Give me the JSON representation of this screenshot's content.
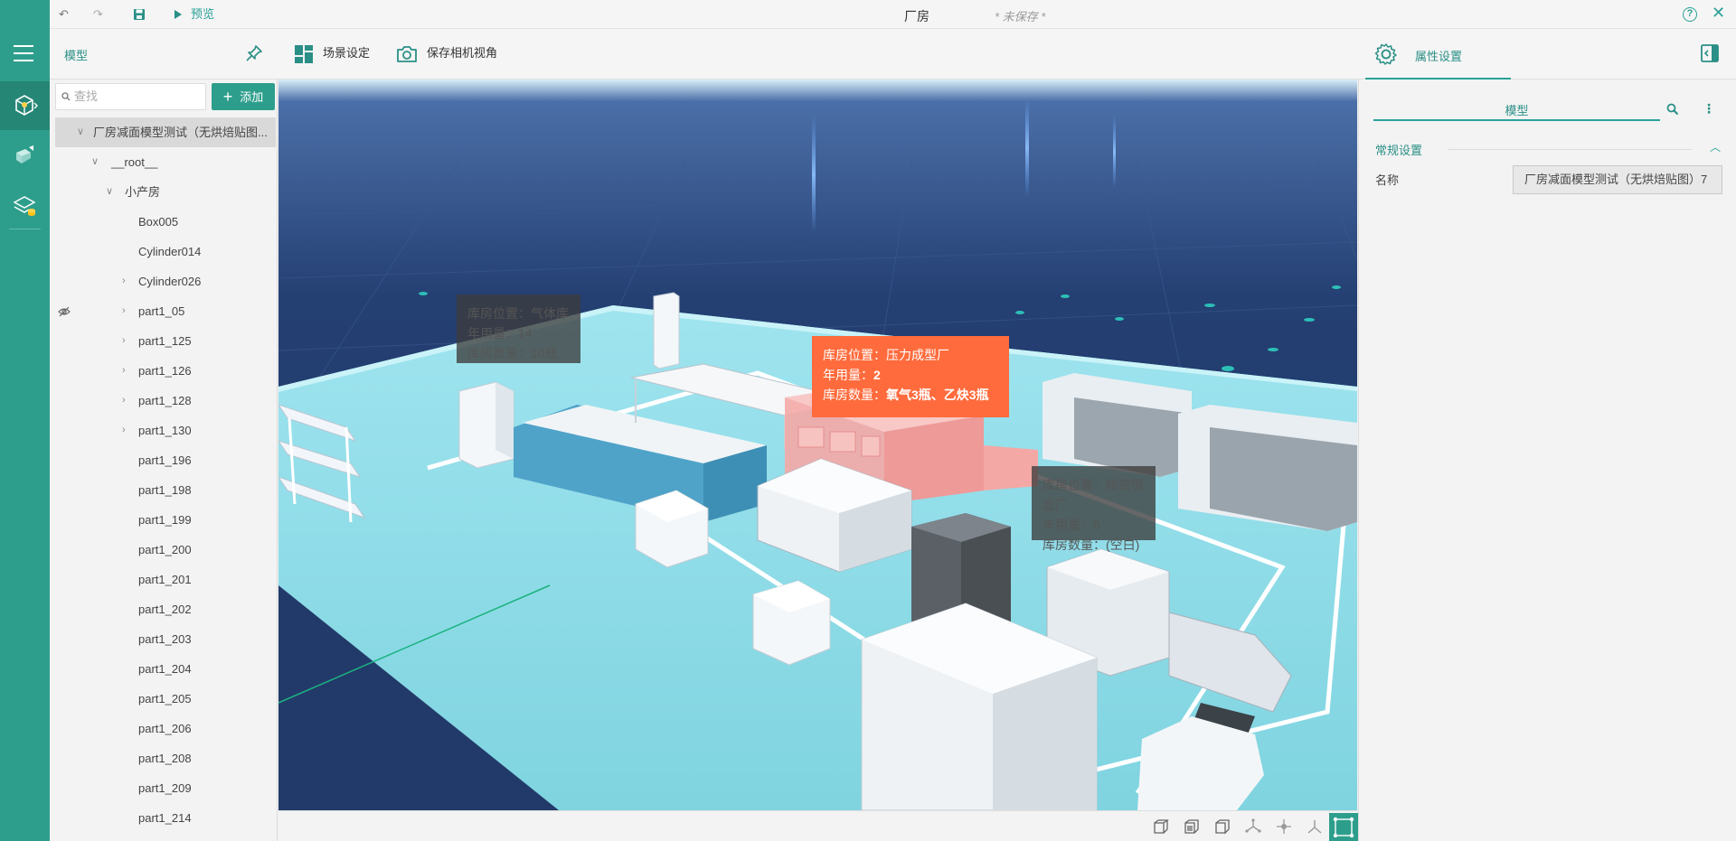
{
  "titlebar": {
    "preview_label": "预览",
    "doc_title": "厂房",
    "unsaved_label": "* 未保存 *",
    "help_label": "?",
    "close_label": "✕"
  },
  "toolbar": {
    "panel_title": "模型",
    "scene_settings_label": "场景设定",
    "save_camera_label": "保存相机视角",
    "properties_tab_label": "属性设置"
  },
  "left_panel": {
    "search_placeholder": "查找",
    "add_label": "添加",
    "tree": [
      {
        "label": "厂房减面模型测试（无烘焙贴图...",
        "arrow": "∨"
      },
      {
        "label": "__root__",
        "arrow": "∨"
      },
      {
        "label": "小产房",
        "arrow": "∨"
      },
      {
        "label": "Box005",
        "arrow": ""
      },
      {
        "label": "Cylinder014",
        "arrow": ""
      },
      {
        "label": "Cylinder026",
        "arrow": "›"
      },
      {
        "label": "part1_05",
        "arrow": "›",
        "hidden": true
      },
      {
        "label": "part1_125",
        "arrow": "›"
      },
      {
        "label": "part1_126",
        "arrow": "›"
      },
      {
        "label": "part1_128",
        "arrow": "›"
      },
      {
        "label": "part1_130",
        "arrow": "›"
      },
      {
        "label": "part1_196",
        "arrow": ""
      },
      {
        "label": "part1_198",
        "arrow": ""
      },
      {
        "label": "part1_199",
        "arrow": ""
      },
      {
        "label": "part1_200",
        "arrow": ""
      },
      {
        "label": "part1_201",
        "arrow": ""
      },
      {
        "label": "part1_202",
        "arrow": ""
      },
      {
        "label": "part1_203",
        "arrow": ""
      },
      {
        "label": "part1_204",
        "arrow": ""
      },
      {
        "label": "part1_205",
        "arrow": ""
      },
      {
        "label": "part1_206",
        "arrow": ""
      },
      {
        "label": "part1_208",
        "arrow": ""
      },
      {
        "label": "part1_209",
        "arrow": ""
      },
      {
        "label": "part1_214",
        "arrow": ""
      }
    ]
  },
  "viewport": {
    "tooltip_active": {
      "location_key": "库房位置：",
      "location_value": "压力成型厂",
      "usage_key": "年用量：",
      "usage_value": "2",
      "stock_key": "库房数量：",
      "stock_value": "氧气3瓶、乙炔3瓶"
    },
    "tooltip_a": {
      "line1": "库房位置：气体库",
      "line2": "年用量：14",
      "line3": "库房数量：10瓶"
    },
    "tooltip_b": {
      "line1": "库房位置：精密锻造厂",
      "line2": "年用量：6",
      "line3": "库房数量：(空白)"
    }
  },
  "right_panel": {
    "tab_label": "模型",
    "more_label": "⋮",
    "section_title": "常规设置",
    "section_chevron": "︿",
    "name_label": "名称",
    "name_value": "厂房减面模型测试（无烘焙贴图）7"
  },
  "colors": {
    "brand": "#2e9e8c",
    "tooltip_active_bg": "#ff6b3c",
    "floor": "#7fd4e0",
    "sky": "#223a6a"
  }
}
